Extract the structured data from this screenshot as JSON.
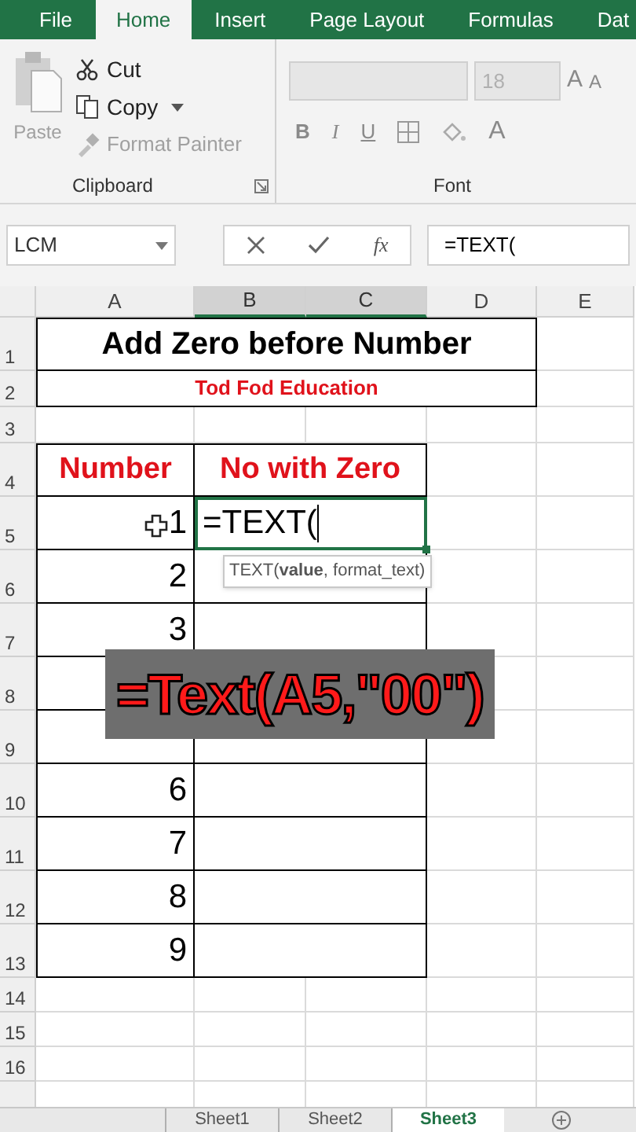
{
  "ribbon_tabs": [
    {
      "label": "File",
      "selected": false
    },
    {
      "label": "Home",
      "selected": true
    },
    {
      "label": "Insert",
      "selected": false
    },
    {
      "label": "Page Layout",
      "selected": false
    },
    {
      "label": "Formulas",
      "selected": false
    },
    {
      "label": "Dat",
      "selected": false
    }
  ],
  "clipboard": {
    "paste": {
      "label": "Paste",
      "disabled": true
    },
    "items": [
      {
        "kind": "cut",
        "label": "Cut",
        "disabled": false
      },
      {
        "kind": "copy",
        "label": "Copy",
        "disabled": false
      },
      {
        "kind": "painter",
        "label": "Format Painter",
        "disabled": true
      }
    ],
    "label": "Clipboard"
  },
  "font": {
    "size": "18",
    "grow": "A",
    "shrink": "A",
    "bold": "B",
    "italic": "I",
    "underline": "U",
    "text_color_letter": "A",
    "label": "Font"
  },
  "formula_bar": {
    "name_box": "LCM",
    "function_label": "fx",
    "value": "=TEXT("
  },
  "columns": [
    {
      "label": "A",
      "selected": false
    },
    {
      "label": "B",
      "selected": true
    },
    {
      "label": "C",
      "selected": true
    },
    {
      "label": "D",
      "selected": false
    },
    {
      "label": "E",
      "selected": false
    }
  ],
  "rows": [
    "1",
    "2",
    "3",
    "4",
    "5",
    "6",
    "7",
    "8",
    "9",
    "10",
    "11",
    "12",
    "13",
    "14",
    "15",
    "16"
  ],
  "sheet": {
    "title": "Add Zero before Number",
    "subtitle": "Tod Fod Education",
    "header_a": "Number",
    "header_b": "No with Zero",
    "values_above_caption": [
      "1",
      "2",
      "3"
    ],
    "values_below_caption": [
      "6",
      "7",
      "8",
      "9"
    ],
    "active_value": "=TEXT(",
    "tooltip": "TEXT(**value**, format_text)"
  },
  "caption": "=Text(A5,\"00\")",
  "sheet_tabs": [
    {
      "label": "Sheet1",
      "selected": false
    },
    {
      "label": "Sheet2",
      "selected": false
    },
    {
      "label": "Sheet3",
      "selected": true
    }
  ]
}
